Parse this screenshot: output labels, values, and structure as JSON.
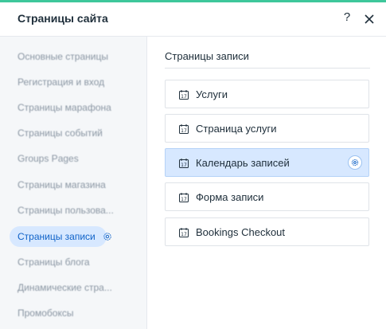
{
  "header": {
    "title": "Страницы сайта",
    "help_label": "?",
    "accent_color": "#3ec79b"
  },
  "sidebar": {
    "items": [
      {
        "label": "Основные страницы",
        "active": false
      },
      {
        "label": "Регистрация и вход",
        "active": false
      },
      {
        "label": "Страницы марафона",
        "active": false
      },
      {
        "label": "Страницы событий",
        "active": false
      },
      {
        "label": "Groups Pages",
        "active": false
      },
      {
        "label": "Страницы магазина",
        "active": false
      },
      {
        "label": "Страницы пользова...",
        "active": false
      },
      {
        "label": "Страницы записи",
        "active": true,
        "icon": "gear-icon"
      },
      {
        "label": "Страницы блога",
        "active": false
      },
      {
        "label": "Динамические стра...",
        "active": false
      },
      {
        "label": "Промобоксы",
        "active": false
      }
    ]
  },
  "main": {
    "section_title": "Страницы записи",
    "pages": [
      {
        "label": "Услуги",
        "icon": "calendar-icon",
        "selected": false
      },
      {
        "label": "Страница услуги",
        "icon": "calendar-icon",
        "selected": false
      },
      {
        "label": "Календарь записей",
        "icon": "calendar-icon",
        "selected": true,
        "action_icon": "gear-icon"
      },
      {
        "label": "Форма записи",
        "icon": "calendar-icon",
        "selected": false
      },
      {
        "label": "Bookings Checkout",
        "icon": "calendar-icon",
        "selected": false
      }
    ]
  },
  "colors": {
    "active_bg": "#d7e8ff",
    "active_text": "#0f62c8",
    "sidebar_bg": "#f5f7f9"
  }
}
